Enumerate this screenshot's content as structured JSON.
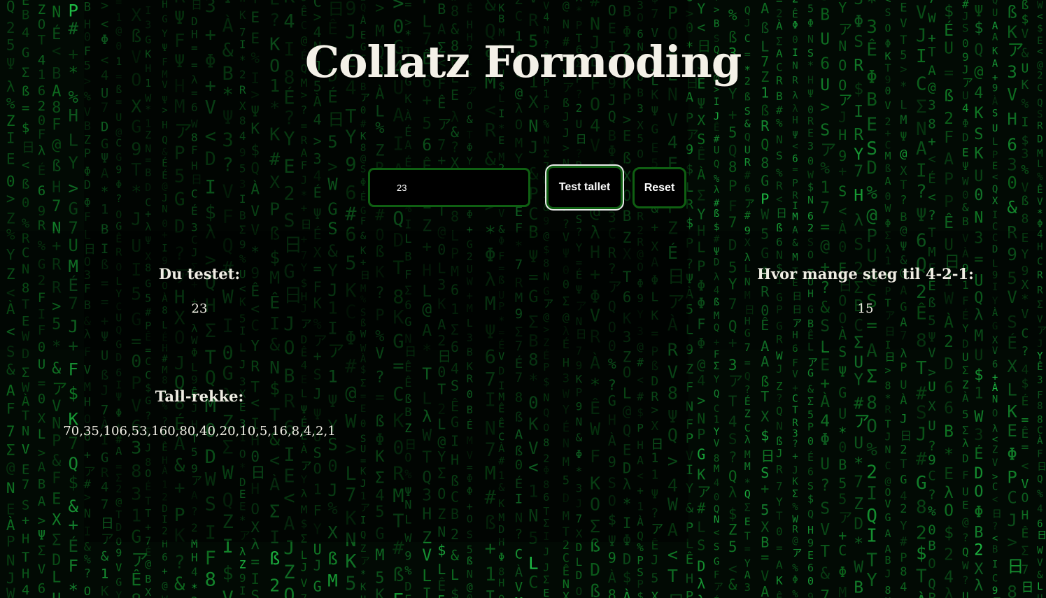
{
  "page": {
    "title": "Collatz Formoding"
  },
  "controls": {
    "number_value": "23",
    "test_button_label": "Test tallet",
    "reset_button_label": "Reset"
  },
  "results": {
    "tested_label": "Du testet:",
    "tested_value": "23",
    "steps_label": "Hvor mange steg til 4-2-1:",
    "steps_value": "15",
    "sequence_label": "Tall-rekke:",
    "sequence_value": "70,35,106,53,160,80,40,20,10,5,16,8,4,2,1"
  },
  "colors": {
    "accent_green": "#0f5f12",
    "background": "#020a04",
    "text": "#f0ede4"
  }
}
